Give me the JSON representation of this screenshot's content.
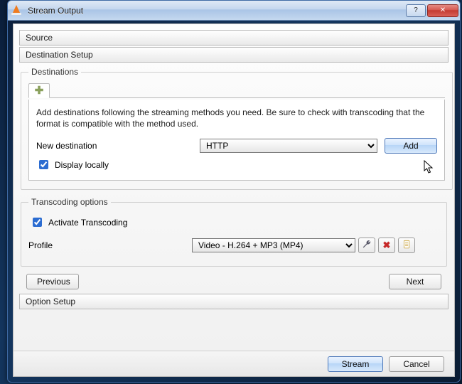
{
  "window": {
    "title": "Stream Output"
  },
  "sections": {
    "source": "Source",
    "destination_setup": "Destination Setup",
    "option_setup": "Option Setup"
  },
  "destinations": {
    "legend": "Destinations",
    "hint": "Add destinations following the streaming methods you need. Be sure to check with transcoding that the format is compatible with the method used.",
    "new_destination_label": "New destination",
    "new_destination_value": "HTTP",
    "add_label": "Add",
    "display_locally_label": "Display locally",
    "display_locally_checked": true
  },
  "transcoding": {
    "legend": "Transcoding options",
    "activate_label": "Activate Transcoding",
    "activate_checked": true,
    "profile_label": "Profile",
    "profile_value": "Video - H.264 + MP3 (MP4)"
  },
  "nav": {
    "previous": "Previous",
    "next": "Next"
  },
  "footer": {
    "stream": "Stream",
    "cancel": "Cancel"
  },
  "icons": {
    "tools": "✖",
    "_tools": "",
    "wrench": "🛠",
    "delete": "✖",
    "new": "📄"
  }
}
